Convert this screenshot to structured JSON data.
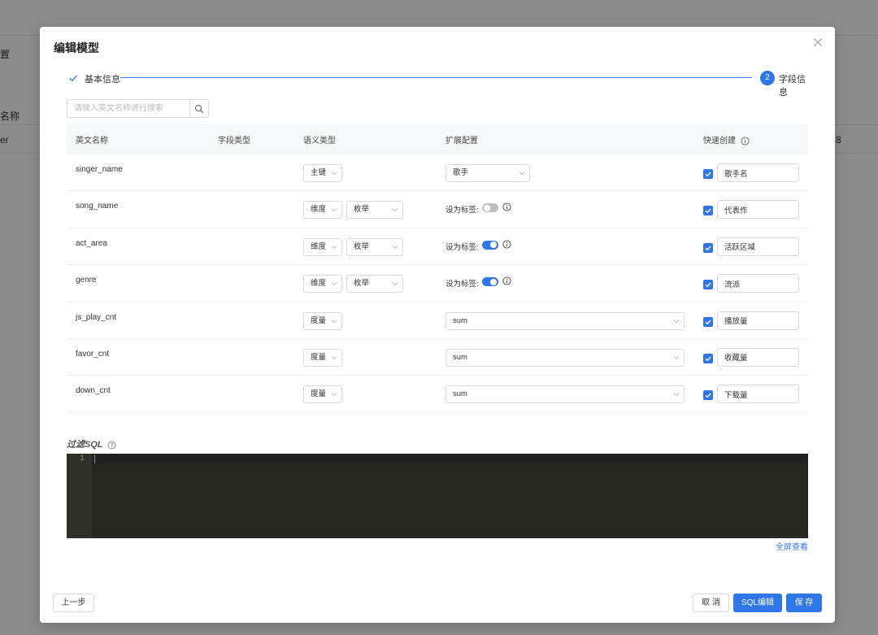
{
  "background": {
    "left_texts": [
      "置",
      "名称",
      "er"
    ],
    "right_text": "8"
  },
  "modal": {
    "title": "编辑模型"
  },
  "steps": {
    "step1": "基本信息",
    "step2_number": "2",
    "step2": "字段信息"
  },
  "search": {
    "placeholder": "请输入英文名称进行搜索"
  },
  "table": {
    "headers": {
      "name": "英文名称",
      "field_type": "字段类型",
      "semantic_type": "语义类型",
      "extension": "扩展配置",
      "quick_create": "快速创建"
    },
    "tag_label": "设为标签:",
    "rows": [
      {
        "name": "singer_name",
        "semantic": "主键",
        "enum": "",
        "ext_select": "歌手",
        "tag": null,
        "quick": "歌手名"
      },
      {
        "name": "song_name",
        "semantic": "维度",
        "enum": "枚举",
        "ext_select": "",
        "tag": "off",
        "quick": "代表作"
      },
      {
        "name": "act_area",
        "semantic": "维度",
        "enum": "枚举",
        "ext_select": "",
        "tag": "on",
        "quick": "活跃区域"
      },
      {
        "name": "genre",
        "semantic": "维度",
        "enum": "枚举",
        "ext_select": "",
        "tag": "on",
        "quick": "流派"
      },
      {
        "name": "js_play_cnt",
        "semantic": "度量",
        "enum": "",
        "ext_select": "sum",
        "tag": null,
        "quick": "播放量"
      },
      {
        "name": "favor_cnt",
        "semantic": "度量",
        "enum": "",
        "ext_select": "sum",
        "tag": null,
        "quick": "收藏量"
      },
      {
        "name": "down_cnt",
        "semantic": "度量",
        "enum": "",
        "ext_select": "sum",
        "tag": null,
        "quick": "下载量"
      }
    ]
  },
  "sql": {
    "label": "过滤SQL",
    "line_number": "1",
    "fullscreen": "全屏查看"
  },
  "footer": {
    "prev": "上一步",
    "cancel": "取 消",
    "sql_edit": "SQL编辑",
    "save": "保 存"
  },
  "colors": {
    "primary": "#2f76e8",
    "editor_bg": "#272822"
  }
}
